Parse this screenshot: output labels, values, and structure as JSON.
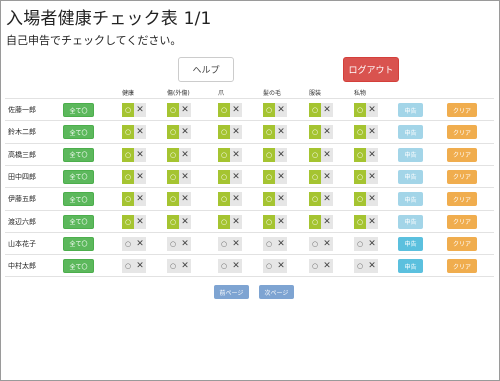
{
  "header": {
    "title": "入場者健康チェック表 1/1",
    "subtitle": "自己申告でチェックしてください。"
  },
  "actions": {
    "help_label": "ヘルプ",
    "logout_label": "ログアウト"
  },
  "columns": [
    "健康",
    "傷(外傷)",
    "爪",
    "髪の毛",
    "服装",
    "私物"
  ],
  "row_controls": {
    "all_label": "全て〇",
    "ok_symbol": "○",
    "ng_symbol": "✕",
    "submit_label": "申告",
    "clear_label": "クリア"
  },
  "rows": [
    {
      "name": "佐藤一郎",
      "checks": [
        true,
        true,
        true,
        true,
        true,
        true
      ]
    },
    {
      "name": "鈴木二郎",
      "checks": [
        true,
        true,
        true,
        true,
        true,
        true
      ]
    },
    {
      "name": "高橋三郎",
      "checks": [
        true,
        true,
        true,
        true,
        true,
        true
      ]
    },
    {
      "name": "田中四郎",
      "checks": [
        true,
        true,
        true,
        true,
        true,
        true
      ]
    },
    {
      "name": "伊藤五郎",
      "checks": [
        true,
        true,
        true,
        true,
        true,
        true
      ]
    },
    {
      "name": "渡辺六郎",
      "checks": [
        true,
        true,
        true,
        true,
        true,
        true
      ]
    },
    {
      "name": "山本花子",
      "checks": [
        false,
        false,
        false,
        false,
        false,
        false
      ]
    },
    {
      "name": "中村太郎",
      "checks": [
        false,
        false,
        false,
        false,
        false,
        false
      ]
    }
  ],
  "pagination": {
    "prev_label": "前ページ",
    "next_label": "次ページ"
  },
  "colors": {
    "all_button": "#5cb85c",
    "checked": "#a5c431",
    "submit_enabled": "#5bc0de",
    "submit_faded": "#a3d5e8",
    "clear": "#f0ad4e",
    "logout": "#d9534f",
    "paging": "#7ea4d2"
  }
}
